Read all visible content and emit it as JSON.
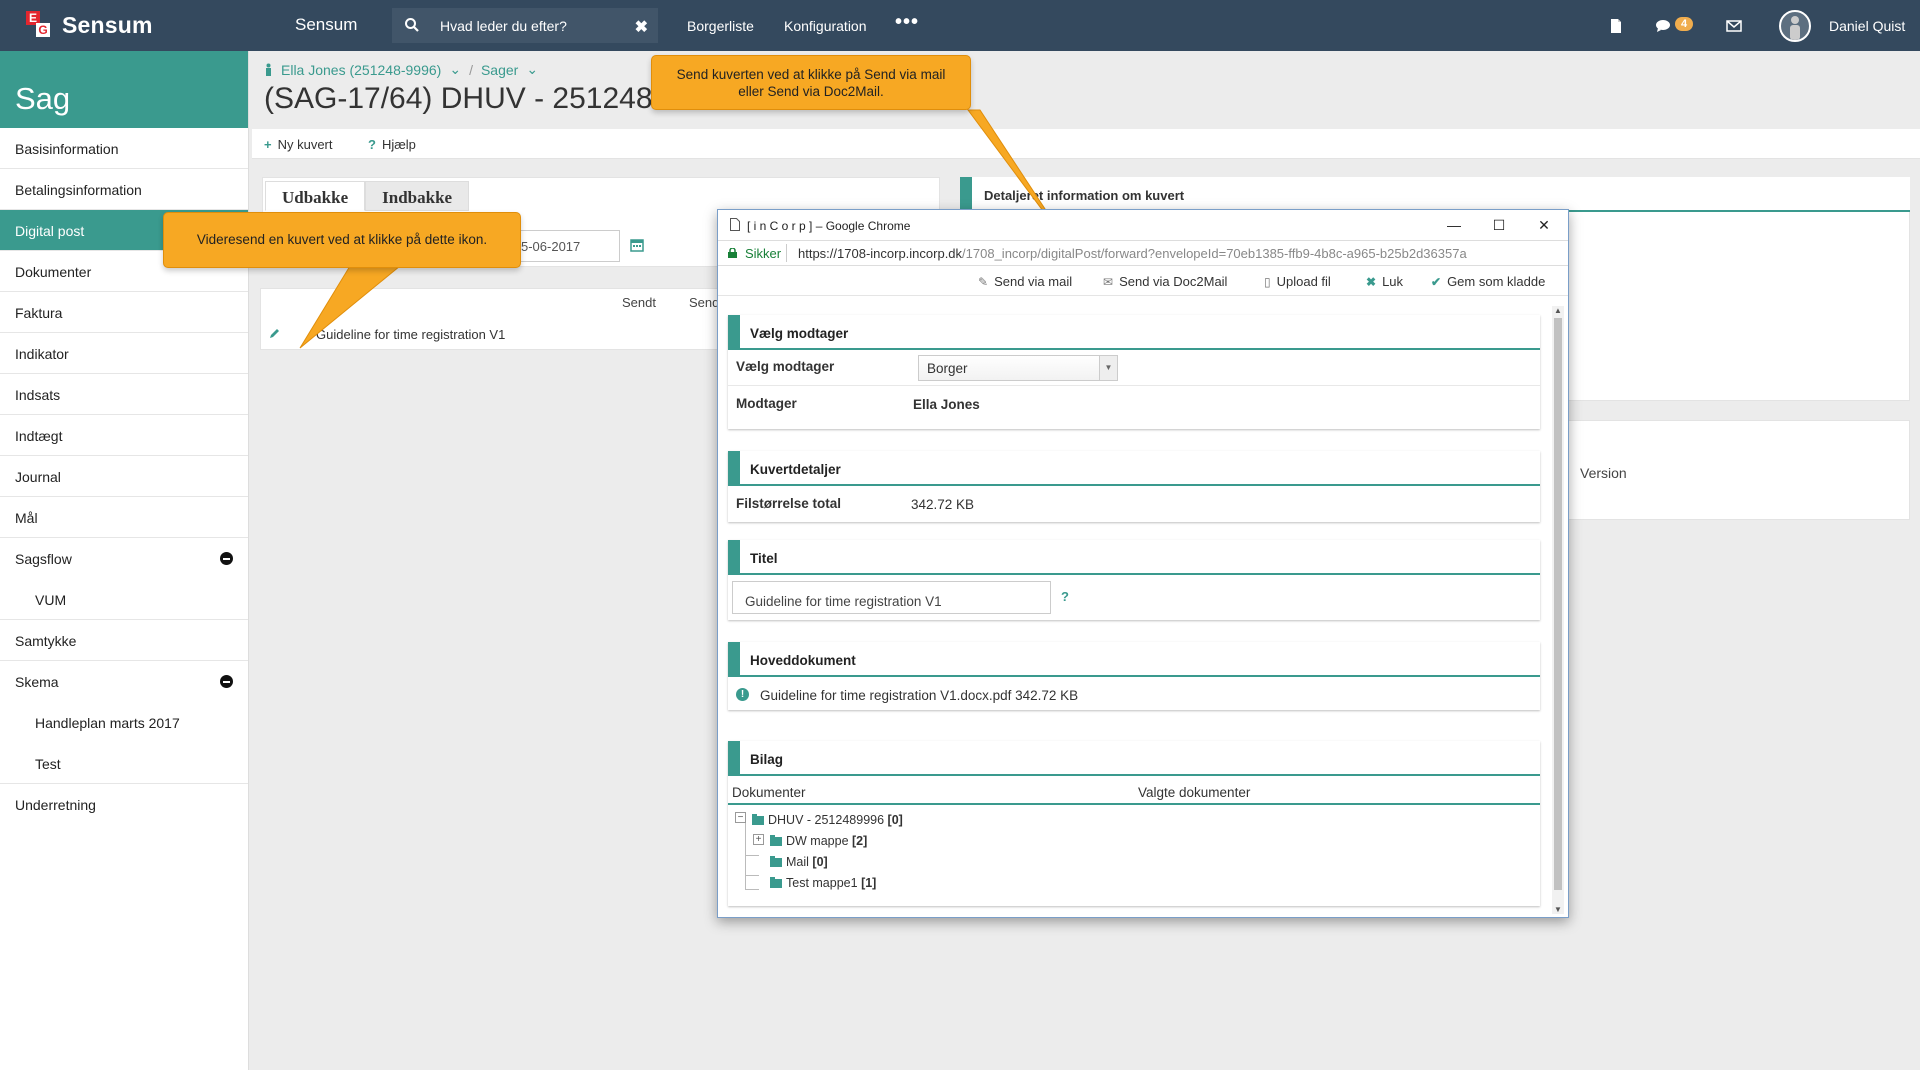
{
  "topbar": {
    "brand": "Sensum",
    "app_name": "Sensum",
    "search_placeholder": "Hvad leder du efter?",
    "nav": [
      "Borgerliste",
      "Konfiguration"
    ],
    "more": "•••",
    "message_count": "4",
    "user": "Daniel Quist"
  },
  "sidebar": {
    "title": "Sag",
    "items": [
      {
        "label": "Basisinformation"
      },
      {
        "label": "Betalingsinformation"
      },
      {
        "label": "Digital post"
      },
      {
        "label": "Dokumenter"
      },
      {
        "label": "Faktura"
      },
      {
        "label": "Indikator"
      },
      {
        "label": "Indsats"
      },
      {
        "label": "Indtægt"
      },
      {
        "label": "Journal"
      },
      {
        "label": "Mål"
      },
      {
        "label": "Sagsflow"
      },
      {
        "label": "VUM"
      },
      {
        "label": "Samtykke"
      },
      {
        "label": "Skema"
      },
      {
        "label": "Handleplan marts 2017"
      },
      {
        "label": "Test"
      },
      {
        "label": "Underretning"
      }
    ]
  },
  "breadcrumb": {
    "person": "Ella Jones (251248-9996)",
    "separator": "/",
    "section": "Sager"
  },
  "page_title": "(SAG-17/64) DHUV - 251248",
  "toolbar": {
    "new_envelope": "Ny kuvert",
    "help": "Hjælp"
  },
  "mailbox": {
    "tabs": [
      "Udbakke",
      "Indbakke"
    ],
    "date_value": "5-06-2017",
    "columns": [
      "Sendt",
      "Send"
    ],
    "row_title": "Guideline for time registration V1"
  },
  "detail_panel": {
    "heading": "Detaljeret information om kuvert",
    "version_label": "Version"
  },
  "tooltips": {
    "forward": "Videresend en kuvert ved at klikke på dette ikon.",
    "send_line1": "Send kuverten ved at klikke på Send via mail",
    "send_line2": "eller Send via Doc2Mail."
  },
  "popup": {
    "window_title": "[ i n C o r p ] – Google Chrome",
    "secure_label": "Sikker",
    "url_main": "https://1708-incorp.incorp.dk",
    "url_rest": "/1708_incorp/digitalPost/forward?envelopeId=70eb1385-ffb9-4b8c-a965-b25b2d36357a",
    "actions": {
      "send_mail": "Send via mail",
      "send_doc2mail": "Send via Doc2Mail",
      "upload": "Upload fil",
      "close": "Luk",
      "save_draft": "Gem som kladde"
    },
    "recipient": {
      "heading": "Vælg modtager",
      "select_label": "Vælg modtager",
      "select_value": "Borger",
      "recipient_label": "Modtager",
      "recipient_value": "Ella Jones"
    },
    "envelope": {
      "heading": "Kuvertdetaljer",
      "size_label": "Filstørrelse total",
      "size_value": "342.72 KB"
    },
    "title_section": {
      "heading": "Titel",
      "value": "Guideline for time registration V1",
      "help": "?"
    },
    "main_document": {
      "heading": "Hoveddokument",
      "value": "Guideline for time registration V1.docx.pdf 342.72 KB"
    },
    "attachments": {
      "heading": "Bilag",
      "col_documents": "Dokumenter",
      "col_selected": "Valgte dokumenter",
      "tree": [
        {
          "name": "DHUV - 2512489996",
          "count": "[0]"
        },
        {
          "name": "DW mappe",
          "count": "[2]"
        },
        {
          "name": "Mail",
          "count": "[0]"
        },
        {
          "name": "Test mappe1",
          "count": "[1]"
        }
      ]
    }
  }
}
